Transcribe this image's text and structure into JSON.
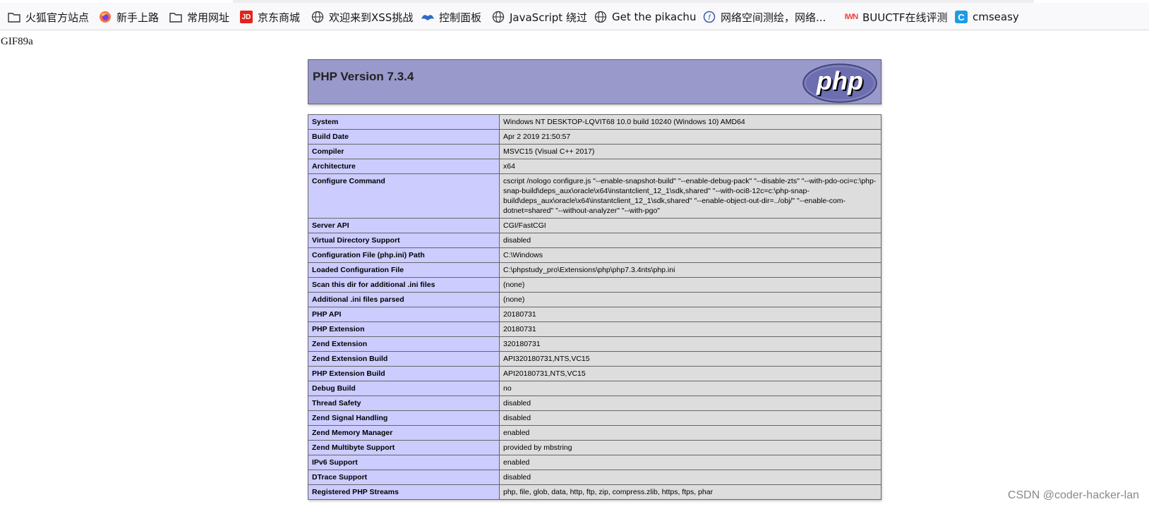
{
  "bookmarks": [
    {
      "label": "火狐官方站点",
      "icon": "folder-icon"
    },
    {
      "label": "新手上路",
      "icon": "firefox-icon"
    },
    {
      "label": "常用网址",
      "icon": "folder-icon"
    },
    {
      "label": "京东商城",
      "icon": "jd-icon",
      "icon_text": "JD"
    },
    {
      "label": "欢迎来到XSS挑战",
      "icon": "globe-icon"
    },
    {
      "label": "控制面板",
      "icon": "control-panel-icon"
    },
    {
      "label": "JavaScript 绕过",
      "icon": "globe-icon"
    },
    {
      "label": "Get the pikachu",
      "icon": "globe-icon"
    },
    {
      "label": "网络空间测绘，网络...",
      "icon": "fofa-icon"
    },
    {
      "label": "BUUCTF在线评测",
      "icon": "buuctf-icon",
      "icon_text": "IWN"
    },
    {
      "label": "cmseasy",
      "icon": "cmseasy-icon",
      "icon_text": "C"
    }
  ],
  "page": {
    "gif_header": "GIF89a",
    "php_version_title": "PHP Version 7.3.4",
    "logo_text": "php"
  },
  "info_rows": [
    {
      "key": "System",
      "value": "Windows NT DESKTOP-LQVIT68 10.0 build 10240 (Windows 10) AMD64"
    },
    {
      "key": "Build Date",
      "value": "Apr 2 2019 21:50:57"
    },
    {
      "key": "Compiler",
      "value": "MSVC15 (Visual C++ 2017)"
    },
    {
      "key": "Architecture",
      "value": "x64"
    },
    {
      "key": "Configure Command",
      "value": "cscript /nologo configure.js \"--enable-snapshot-build\" \"--enable-debug-pack\" \"--disable-zts\" \"--with-pdo-oci=c:\\php-snap-build\\deps_aux\\oracle\\x64\\instantclient_12_1\\sdk,shared\" \"--with-oci8-12c=c:\\php-snap-build\\deps_aux\\oracle\\x64\\instantclient_12_1\\sdk,shared\" \"--enable-object-out-dir=../obj/\" \"--enable-com-dotnet=shared\" \"--without-analyzer\" \"--with-pgo\""
    },
    {
      "key": "Server API",
      "value": "CGI/FastCGI"
    },
    {
      "key": "Virtual Directory Support",
      "value": "disabled"
    },
    {
      "key": "Configuration File (php.ini) Path",
      "value": "C:\\Windows"
    },
    {
      "key": "Loaded Configuration File",
      "value": "C:\\phpstudy_pro\\Extensions\\php\\php7.3.4nts\\php.ini"
    },
    {
      "key": "Scan this dir for additional .ini files",
      "value": "(none)"
    },
    {
      "key": "Additional .ini files parsed",
      "value": "(none)"
    },
    {
      "key": "PHP API",
      "value": "20180731"
    },
    {
      "key": "PHP Extension",
      "value": "20180731"
    },
    {
      "key": "Zend Extension",
      "value": "320180731"
    },
    {
      "key": "Zend Extension Build",
      "value": "API320180731,NTS,VC15"
    },
    {
      "key": "PHP Extension Build",
      "value": "API20180731,NTS,VC15"
    },
    {
      "key": "Debug Build",
      "value": "no"
    },
    {
      "key": "Thread Safety",
      "value": "disabled"
    },
    {
      "key": "Zend Signal Handling",
      "value": "disabled"
    },
    {
      "key": "Zend Memory Manager",
      "value": "enabled"
    },
    {
      "key": "Zend Multibyte Support",
      "value": "provided by mbstring"
    },
    {
      "key": "IPv6 Support",
      "value": "enabled"
    },
    {
      "key": "DTrace Support",
      "value": "disabled"
    },
    {
      "key": "Registered PHP Streams",
      "value": "php, file, glob, data, http, ftp, zip, compress.zlib, https, ftps, phar"
    }
  ],
  "watermark": "CSDN @coder-hacker-lan",
  "colors": {
    "header_bg": "#9999cc",
    "key_cell_bg": "#ccccff",
    "value_cell_bg": "#dddddd",
    "border": "#666666"
  }
}
